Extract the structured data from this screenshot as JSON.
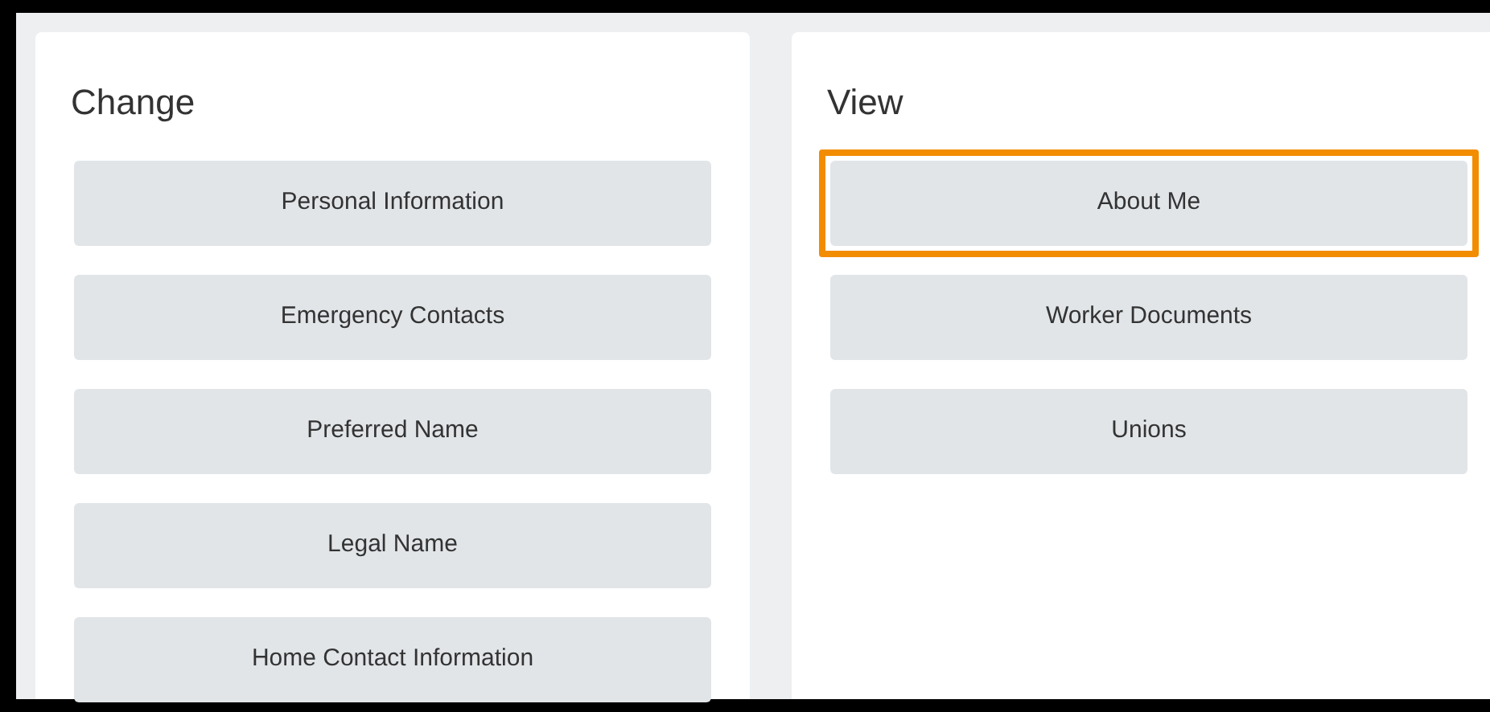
{
  "panels": [
    {
      "title": "Change",
      "items": [
        {
          "label": "Personal Information",
          "highlighted": false
        },
        {
          "label": "Emergency Contacts",
          "highlighted": false
        },
        {
          "label": "Preferred Name",
          "highlighted": false
        },
        {
          "label": "Legal Name",
          "highlighted": false
        },
        {
          "label": "Home Contact Information",
          "highlighted": false
        }
      ]
    },
    {
      "title": "View",
      "items": [
        {
          "label": "About Me",
          "highlighted": true
        },
        {
          "label": "Worker Documents",
          "highlighted": false
        },
        {
          "label": "Unions",
          "highlighted": false
        }
      ]
    }
  ]
}
